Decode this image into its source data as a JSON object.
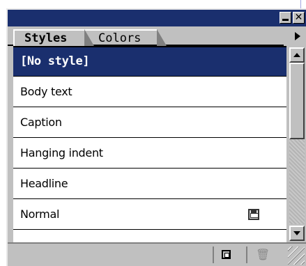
{
  "window": {
    "minimize_symbol": "",
    "close_symbol": "✕"
  },
  "tabs": [
    {
      "label": "Styles",
      "active": true
    },
    {
      "label": "Colors",
      "active": false
    }
  ],
  "styles_list": [
    {
      "label": "[No style]",
      "selected": true
    },
    {
      "label": "Body text",
      "selected": false
    },
    {
      "label": "Caption",
      "selected": false
    },
    {
      "label": "Hanging indent",
      "selected": false
    },
    {
      "label": "Headline",
      "selected": false
    },
    {
      "label": "Normal",
      "selected": false,
      "icon": "save-icon"
    }
  ],
  "bottom_toolbar": {
    "new_style_icon": "new-style-icon",
    "delete_icon_glyph": "🗑"
  },
  "colors": {
    "titlebar": "#1a2f6e",
    "selection": "#1a2f6e",
    "chrome": "#c0c0c0"
  }
}
